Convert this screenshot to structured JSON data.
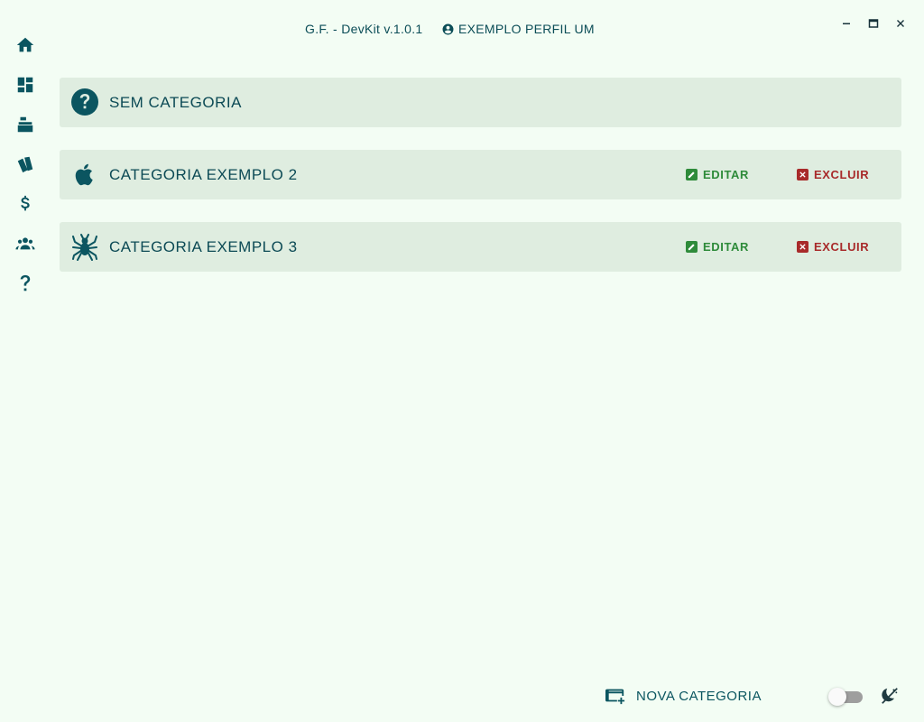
{
  "window": {
    "title": "G.F. - DevKit v.1.0.1",
    "profile_name": "EXEMPLO PERFIL UM",
    "controls": [
      "minimize-icon",
      "maximize-icon",
      "close-icon"
    ]
  },
  "sidebar": {
    "items": [
      {
        "id": "home",
        "icon": "home-icon"
      },
      {
        "id": "dashboard",
        "icon": "dashboard-icon"
      },
      {
        "id": "cash-register",
        "icon": "cash-register-icon"
      },
      {
        "id": "categories",
        "icon": "category-cards-icon"
      },
      {
        "id": "finance",
        "icon": "dollar-icon"
      },
      {
        "id": "people",
        "icon": "people-icon"
      },
      {
        "id": "help",
        "icon": "question-icon"
      }
    ]
  },
  "categories": [
    {
      "label": "SEM CATEGORIA",
      "icon": "question-circle-icon",
      "editable": false
    },
    {
      "label": "CATEGORIA EXEMPLO 2",
      "icon": "apple-icon",
      "editable": true
    },
    {
      "label": "CATEGORIA EXEMPLO 3",
      "icon": "spider-icon",
      "editable": true
    }
  ],
  "actions": {
    "edit_label": "EDITAR",
    "delete_label": "EXCLUIR"
  },
  "footer": {
    "new_category_label": "NOVA CATEGORIA",
    "dark_mode_toggle": false
  },
  "colors": {
    "background": "#f3fdf4",
    "card": "#dfede0",
    "primary": "#0b5560",
    "edit": "#2e8b3a",
    "delete": "#a82a2a"
  }
}
